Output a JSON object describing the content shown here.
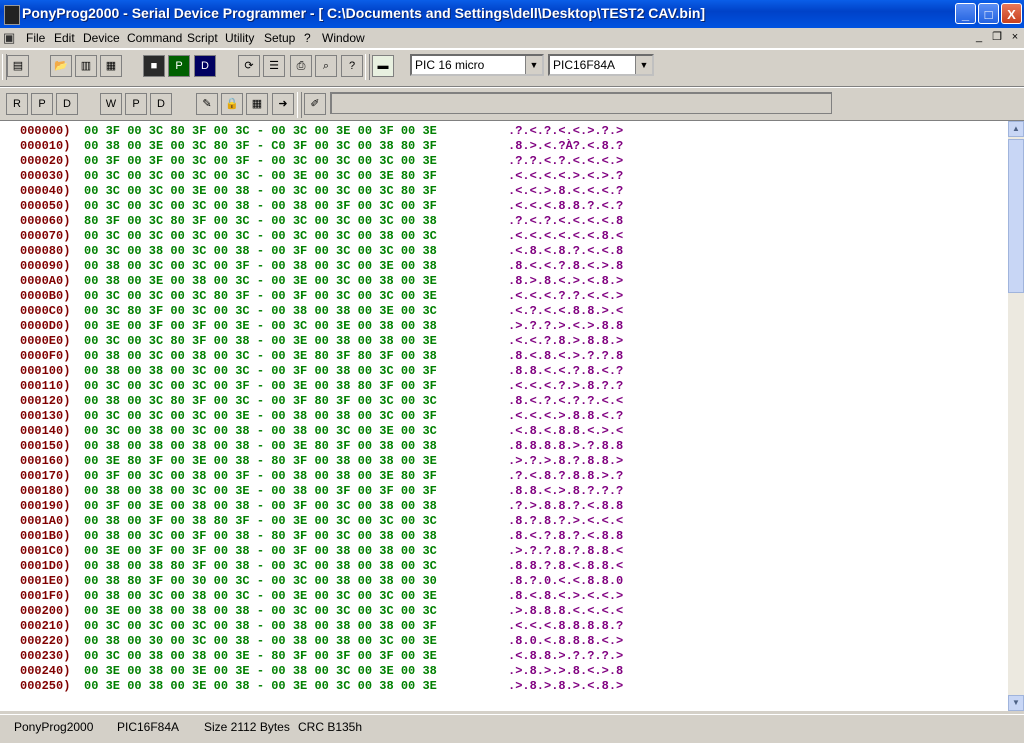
{
  "window": {
    "title": "PonyProg2000 - Serial Device Programmer - [ C:\\Documents and Settings\\dell\\Desktop\\TEST2 CAV.bin]",
    "minimize_label": "_",
    "maximize_label": "□",
    "close_label": "X"
  },
  "menu": {
    "items": [
      "File",
      "Edit",
      "Device",
      "Command",
      "Script",
      "Utility",
      "Setup",
      "?",
      "Window"
    ],
    "mdi_minimize": "_",
    "mdi_restore": "❐",
    "mdi_close": "×"
  },
  "toolbar": {
    "device_family": "PIC 16 micro",
    "device_model": "PIC16F84A",
    "command_text": ""
  },
  "hex_rows": [
    {
      "addr": "000000)",
      "hex": "00 3F 00 3C 80 3F 00 3C - 00 3C 00 3E 00 3F 00 3E",
      "ascii": ".?.<.?.<.<.>.?.>"
    },
    {
      "addr": "000010)",
      "hex": "00 38 00 3E 00 3C 80 3F - C0 3F 00 3C 00 38 80 3F",
      "ascii": ".8.>.<.?À?.<.8.?"
    },
    {
      "addr": "000020)",
      "hex": "00 3F 00 3F 00 3C 00 3F - 00 3C 00 3C 00 3C 00 3E",
      "ascii": ".?.?.<.?.<.<.<.>"
    },
    {
      "addr": "000030)",
      "hex": "00 3C 00 3C 00 3C 00 3C - 00 3E 00 3C 00 3E 80 3F",
      "ascii": ".<.<.<.<.>.<.>.?"
    },
    {
      "addr": "000040)",
      "hex": "00 3C 00 3C 00 3E 00 38 - 00 3C 00 3C 00 3C 80 3F",
      "ascii": ".<.<.>.8.<.<.<.?"
    },
    {
      "addr": "000050)",
      "hex": "00 3C 00 3C 00 3C 00 38 - 00 38 00 3F 00 3C 00 3F",
      "ascii": ".<.<.<.8.8.?.<.?"
    },
    {
      "addr": "000060)",
      "hex": "80 3F 00 3C 80 3F 00 3C - 00 3C 00 3C 00 3C 00 38",
      "ascii": ".?.<.?.<.<.<.<.8"
    },
    {
      "addr": "000070)",
      "hex": "00 3C 00 3C 00 3C 00 3C - 00 3C 00 3C 00 38 00 3C",
      "ascii": ".<.<.<.<.<.<.8.<"
    },
    {
      "addr": "000080)",
      "hex": "00 3C 00 38 00 3C 00 38 - 00 3F 00 3C 00 3C 00 38",
      "ascii": ".<.8.<.8.?.<.<.8"
    },
    {
      "addr": "000090)",
      "hex": "00 38 00 3C 00 3C 00 3F - 00 38 00 3C 00 3E 00 38",
      "ascii": ".8.<.<.?.8.<.>.8"
    },
    {
      "addr": "0000A0)",
      "hex": "00 38 00 3E 00 38 00 3C - 00 3E 00 3C 00 38 00 3E",
      "ascii": ".8.>.8.<.>.<.8.>"
    },
    {
      "addr": "0000B0)",
      "hex": "00 3C 00 3C 00 3C 80 3F - 00 3F 00 3C 00 3C 00 3E",
      "ascii": ".<.<.<.?.?.<.<.>"
    },
    {
      "addr": "0000C0)",
      "hex": "00 3C 80 3F 00 3C 00 3C - 00 38 00 38 00 3E 00 3C",
      "ascii": ".<.?.<.<.8.8.>.<"
    },
    {
      "addr": "0000D0)",
      "hex": "00 3E 00 3F 00 3F 00 3E - 00 3C 00 3E 00 38 00 38",
      "ascii": ".>.?.?.>.<.>.8.8"
    },
    {
      "addr": "0000E0)",
      "hex": "00 3C 00 3C 80 3F 00 38 - 00 3E 00 38 00 38 00 3E",
      "ascii": ".<.<.?.8.>.8.8.>"
    },
    {
      "addr": "0000F0)",
      "hex": "00 38 00 3C 00 38 00 3C - 00 3E 80 3F 80 3F 00 38",
      "ascii": ".8.<.8.<.>.?.?.8"
    },
    {
      "addr": "000100)",
      "hex": "00 38 00 38 00 3C 00 3C - 00 3F 00 38 00 3C 00 3F",
      "ascii": ".8.8.<.<.?.8.<.?"
    },
    {
      "addr": "000110)",
      "hex": "00 3C 00 3C 00 3C 00 3F - 00 3E 00 38 80 3F 00 3F",
      "ascii": ".<.<.<.?.>.8.?.?"
    },
    {
      "addr": "000120)",
      "hex": "00 38 00 3C 80 3F 00 3C - 00 3F 80 3F 00 3C 00 3C",
      "ascii": ".8.<.?.<.?.?.<.<"
    },
    {
      "addr": "000130)",
      "hex": "00 3C 00 3C 00 3C 00 3E - 00 38 00 38 00 3C 00 3F",
      "ascii": ".<.<.<.>.8.8.<.?"
    },
    {
      "addr": "000140)",
      "hex": "00 3C 00 38 00 3C 00 38 - 00 38 00 3C 00 3E 00 3C",
      "ascii": ".<.8.<.8.8.<.>.<"
    },
    {
      "addr": "000150)",
      "hex": "00 38 00 38 00 38 00 38 - 00 3E 80 3F 00 38 00 38",
      "ascii": ".8.8.8.8.>.?.8.8"
    },
    {
      "addr": "000160)",
      "hex": "00 3E 80 3F 00 3E 00 38 - 80 3F 00 38 00 38 00 3E",
      "ascii": ".>.?.>.8.?.8.8.>"
    },
    {
      "addr": "000170)",
      "hex": "00 3F 00 3C 00 38 00 3F - 00 38 00 38 00 3E 80 3F",
      "ascii": ".?.<.8.?.8.8.>.?"
    },
    {
      "addr": "000180)",
      "hex": "00 38 00 38 00 3C 00 3E - 00 38 00 3F 00 3F 00 3F",
      "ascii": ".8.8.<.>.8.?.?.?"
    },
    {
      "addr": "000190)",
      "hex": "00 3F 00 3E 00 38 00 38 - 00 3F 00 3C 00 38 00 38",
      "ascii": ".?.>.8.8.?.<.8.8"
    },
    {
      "addr": "0001A0)",
      "hex": "00 38 00 3F 00 38 80 3F - 00 3E 00 3C 00 3C 00 3C",
      "ascii": ".8.?.8.?.>.<.<.<"
    },
    {
      "addr": "0001B0)",
      "hex": "00 38 00 3C 00 3F 00 38 - 80 3F 00 3C 00 38 00 38",
      "ascii": ".8.<.?.8.?.<.8.8"
    },
    {
      "addr": "0001C0)",
      "hex": "00 3E 00 3F 00 3F 00 38 - 00 3F 00 38 00 38 00 3C",
      "ascii": ".>.?.?.8.?.8.8.<"
    },
    {
      "addr": "0001D0)",
      "hex": "00 38 00 38 80 3F 00 38 - 00 3C 00 38 00 38 00 3C",
      "ascii": ".8.8.?.8.<.8.8.<"
    },
    {
      "addr": "0001E0)",
      "hex": "00 38 80 3F 00 30 00 3C - 00 3C 00 38 00 38 00 30",
      "ascii": ".8.?.0.<.<.8.8.0"
    },
    {
      "addr": "0001F0)",
      "hex": "00 38 00 3C 00 38 00 3C - 00 3E 00 3C 00 3C 00 3E",
      "ascii": ".8.<.8.<.>.<.<.>"
    },
    {
      "addr": "000200)",
      "hex": "00 3E 00 38 00 38 00 38 - 00 3C 00 3C 00 3C 00 3C",
      "ascii": ".>.8.8.8.<.<.<.<"
    },
    {
      "addr": "000210)",
      "hex": "00 3C 00 3C 00 3C 00 38 - 00 38 00 38 00 38 00 3F",
      "ascii": ".<.<.<.8.8.8.8.?"
    },
    {
      "addr": "000220)",
      "hex": "00 38 00 30 00 3C 00 38 - 00 38 00 38 00 3C 00 3E",
      "ascii": ".8.0.<.8.8.8.<.>"
    },
    {
      "addr": "000230)",
      "hex": "00 3C 00 38 00 38 00 3E - 80 3F 00 3F 00 3F 00 3E",
      "ascii": ".<.8.8.>.?.?.?.>"
    },
    {
      "addr": "000240)",
      "hex": "00 3E 00 38 00 3E 00 3E - 00 38 00 3C 00 3E 00 38",
      "ascii": ".>.8.>.>.8.<.>.8"
    },
    {
      "addr": "000250)",
      "hex": "00 3E 00 38 00 3E 00 38 - 00 3E 00 3C 00 38 00 3E",
      "ascii": ".>.8.>.8.>.<.8.>"
    }
  ],
  "status": {
    "app": "PonyProg2000",
    "device": "PIC16F84A",
    "size": "Size  2112 Bytes",
    "crc": "CRC  B135h"
  },
  "icons": [
    "app-icon",
    "open-icon",
    "save-icon",
    "reload-icon",
    "print-icon",
    "search-icon",
    "help-icon",
    "chip-icon",
    "read-icon",
    "write-icon",
    "erase-icon",
    "lock-icon",
    "edit-icon"
  ]
}
